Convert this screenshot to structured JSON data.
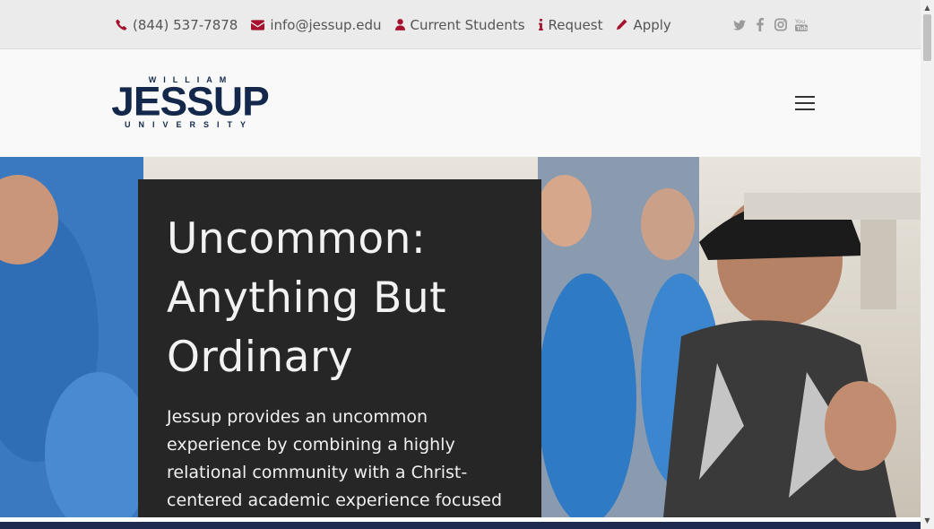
{
  "topbar": {
    "phone": "(844) 537-7878",
    "email": "info@jessup.edu",
    "students": "Current Students",
    "request": "Request",
    "apply": "Apply",
    "social_icons": [
      "twitter-icon",
      "facebook-icon",
      "instagram-icon",
      "youtube-icon"
    ]
  },
  "logo": {
    "top_text": "WILLIAM",
    "main_text": "JESSUP",
    "bottom_text": "UNIVERSITY"
  },
  "hero": {
    "title_lines": [
      "Uncommon:",
      "Anything But",
      "Ordinary"
    ],
    "body": "Jessup provides an uncommon experience by combining a highly relational community with a Christ-centered academic experience focused on how to"
  },
  "colors": {
    "accent": "#a4122e",
    "brand_navy": "#14284b",
    "topbar_bg": "#ebebeb",
    "card_bg": "#262626"
  }
}
